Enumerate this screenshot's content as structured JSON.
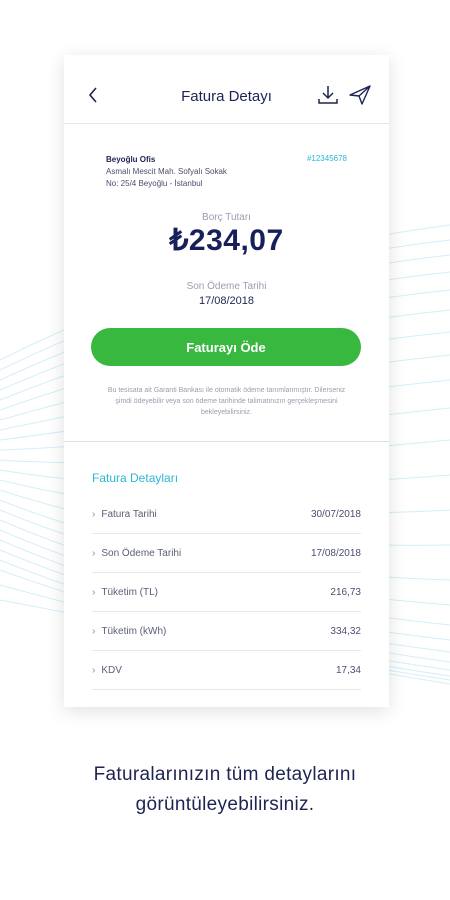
{
  "header": {
    "title": "Fatura Detayı"
  },
  "address": {
    "name": "Beyoğlu Ofis",
    "line1": "Asmalı Mescit Mah. Sofyalı Sokak",
    "line2": "No: 25/4 Beyoğlu - İstanbul"
  },
  "invoice_no": "#12345678",
  "debt": {
    "label": "Borç Tutarı",
    "amount": "₺234,07"
  },
  "due": {
    "label": "Son Ödeme Tarihi",
    "date": "17/08/2018"
  },
  "pay_button": "Faturayı Öde",
  "notice": "Bu tesisata ait Garanti Bankası ile otomatik ödeme tanımlanmıştır. Dilerseniz şimdi ödeyebilir veya son ödeme tarihinde talimatınızın gerçekleşmesini bekleyebilirsiniz.",
  "details": {
    "title": "Fatura Detayları",
    "rows": [
      {
        "label": "Fatura Tarihi",
        "value": "30/07/2018"
      },
      {
        "label": "Son Ödeme Tarihi",
        "value": "17/08/2018"
      },
      {
        "label": "Tüketim (TL)",
        "value": "216,73"
      },
      {
        "label": "Tüketim (kWh)",
        "value": "334,32"
      },
      {
        "label": "KDV",
        "value": "17,34"
      }
    ]
  },
  "caption": {
    "line1": "Faturalarınızın tüm detaylarını",
    "line2": "görüntüleyebilirsiniz."
  },
  "colors": {
    "accent": "#2cb7d5",
    "pay": "#38b83e",
    "navy": "#17205a"
  }
}
